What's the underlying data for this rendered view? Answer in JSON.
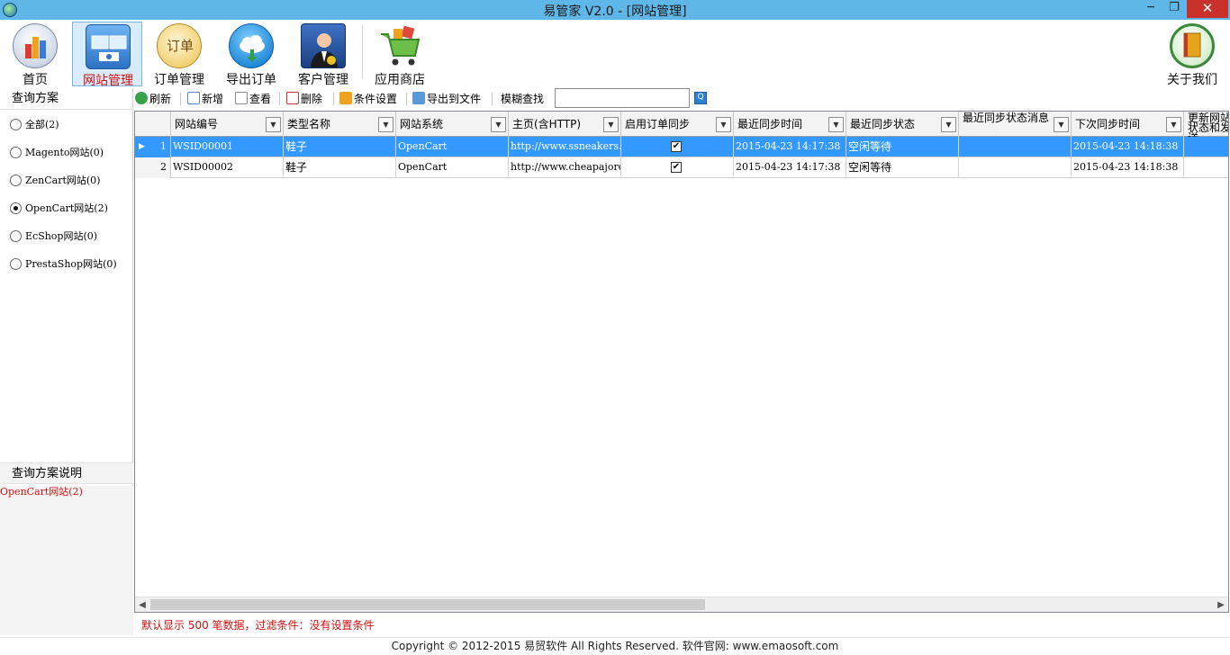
{
  "window": {
    "title": "易管家 V2.0 - [网站管理]",
    "min_glyph": "─",
    "max_glyph": "❐",
    "close_glyph": "✕"
  },
  "toolbar": {
    "items": [
      {
        "label": "首页",
        "icon": "bar-chart-icon"
      },
      {
        "label": "网站管理",
        "icon": "website-manage-icon"
      },
      {
        "label": "订单管理",
        "icon": "order-icon"
      },
      {
        "label": "导出订单",
        "icon": "cloud-export-icon"
      },
      {
        "label": "客户管理",
        "icon": "customer-icon"
      },
      {
        "label": "应用商店",
        "icon": "shopping-cart-icon"
      },
      {
        "label": "关于我们",
        "icon": "book-icon"
      }
    ],
    "order_icon_text": "订单"
  },
  "left_panel": {
    "title": "查询方案",
    "options": [
      {
        "label": "全部(2)",
        "selected": false
      },
      {
        "label": "Magento网站(0)",
        "selected": false
      },
      {
        "label": "ZenCart网站(0)",
        "selected": false
      },
      {
        "label": "OpenCart网站(2)",
        "selected": true
      },
      {
        "label": "EcShop网站(0)",
        "selected": false
      },
      {
        "label": "PrestaShop网站(0)",
        "selected": false
      }
    ],
    "desc_title": "查询方案说明",
    "desc_text": "OpenCart网站(2)"
  },
  "subbar": {
    "refresh": "刷新",
    "add": "新增",
    "view": "查看",
    "delete": "删除",
    "conditions": "条件设置",
    "export": "导出到文件",
    "fuzzy": "模糊查找",
    "search_value": "",
    "search_glyph": "Q"
  },
  "grid": {
    "columns": [
      "网站编号",
      "类型名称",
      "网站系统",
      "主页(含HTTP)",
      "启用订单同步",
      "最近同步时间",
      "最近同步状态",
      "最近同步状态消息",
      "下次同步时间",
      "更新网站状态和发送"
    ],
    "rows": [
      {
        "index": "1",
        "id": "WSID00001",
        "type": "鞋子",
        "system": "OpenCart",
        "homepage": "http://www.ssneakers.",
        "sync": true,
        "last_time": "2015-04-23 14:17:38",
        "last_status": "空闲等待",
        "last_msg": "",
        "next_time": "2015-04-23 14:18:38"
      },
      {
        "index": "2",
        "id": "WSID00002",
        "type": "鞋子",
        "system": "OpenCart",
        "homepage": "http://www.cheapajord",
        "sync": true,
        "last_time": "2015-04-23 14:17:38",
        "last_status": "空闲等待",
        "last_msg": "",
        "next_time": "2015-04-23 14:18:38"
      }
    ],
    "check_glyph": "✔",
    "dropdown_glyph": "▼",
    "row_arrow": "▶"
  },
  "status_text": "默认显示 500 笔数据，过滤条件：没有设置条件",
  "footer_text": "Copyright © 2012-2015 易贸软件 All Rights Reserved. 软件官网: www.emaosoft.com",
  "colors": {
    "titlebar": "#5fb7e8",
    "selected_row": "#3399ff",
    "accent_red": "#d01010"
  }
}
